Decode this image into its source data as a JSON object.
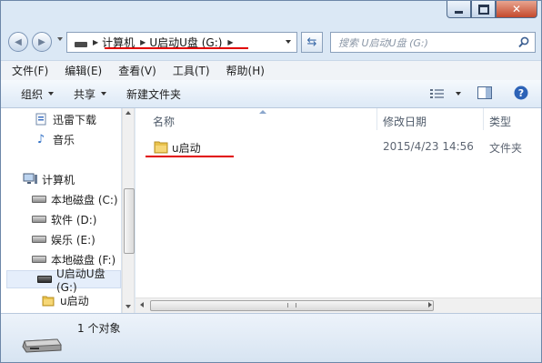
{
  "address": {
    "segments": [
      "计算机",
      "U启动U盘 (G:)"
    ]
  },
  "search": {
    "placeholder": "搜索 U启动U盘 (G:)"
  },
  "menu": [
    "文件(F)",
    "编辑(E)",
    "查看(V)",
    "工具(T)",
    "帮助(H)"
  ],
  "toolbar": {
    "organize": "组织",
    "share": "共享",
    "new_folder": "新建文件夹"
  },
  "nav": {
    "items": [
      {
        "label": "迅雷下载",
        "icon": "download-folder-icon"
      },
      {
        "label": "音乐",
        "icon": "music-icon"
      },
      {
        "label": "计算机",
        "icon": "computer-icon"
      },
      {
        "label": "本地磁盘 (C:)",
        "icon": "drive-icon"
      },
      {
        "label": "软件 (D:)",
        "icon": "drive-icon"
      },
      {
        "label": "娱乐 (E:)",
        "icon": "drive-icon"
      },
      {
        "label": "本地磁盘 (F:)",
        "icon": "drive-icon"
      },
      {
        "label": "U启动U盘 (G:)",
        "icon": "usb-drive-icon"
      },
      {
        "label": "u启动",
        "icon": "folder-icon"
      }
    ]
  },
  "columns": {
    "name": "名称",
    "date": "修改日期",
    "type": "类型"
  },
  "files": [
    {
      "name": "u启动",
      "date": "2015/4/23 14:56",
      "type": "文件夹"
    }
  ],
  "status": {
    "count": "1 个对象"
  },
  "colors": {
    "highlight_underline": "#e10000",
    "window_frame": "#dbe8f5",
    "selection": "#e5eefb"
  }
}
